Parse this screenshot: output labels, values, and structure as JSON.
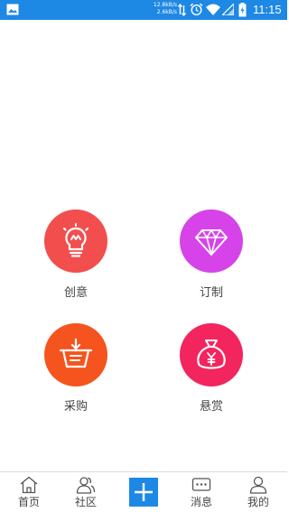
{
  "status_bar": {
    "speed_up": "12.8kB/s",
    "speed_down": "2.6kB/s",
    "time": "11:15",
    "icons": [
      "gallery-icon",
      "data-updown-icon",
      "alarm-icon",
      "wifi-icon",
      "signal-icon",
      "battery-charging-icon"
    ]
  },
  "menu": {
    "items": [
      {
        "label": "创意",
        "icon": "lightbulb-icon",
        "color": "#f24e4e"
      },
      {
        "label": "订制",
        "icon": "diamond-icon",
        "color": "#d644e9"
      },
      {
        "label": "采购",
        "icon": "basket-icon",
        "color": "#f5541f"
      },
      {
        "label": "悬赏",
        "icon": "money-bag-icon",
        "color": "#f2255f"
      }
    ]
  },
  "bottom_nav": {
    "items": [
      {
        "label": "首页",
        "icon": "home-icon"
      },
      {
        "label": "社区",
        "icon": "community-icon"
      },
      {
        "label": "消息",
        "icon": "message-icon"
      },
      {
        "label": "我的",
        "icon": "profile-icon"
      }
    ],
    "add_icon": "plus-icon",
    "accent": "#1e88e5"
  }
}
